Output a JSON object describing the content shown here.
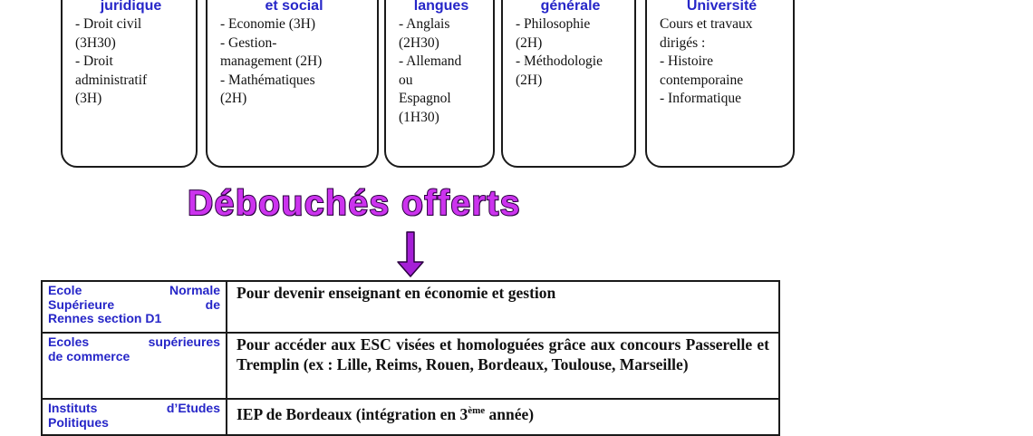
{
  "boxes": [
    {
      "title": "juridique",
      "lines": [
        "- Droit civil",
        "(3H30)",
        "- Droit",
        "administratif",
        "(3H)"
      ]
    },
    {
      "title": "et social",
      "lines": [
        "- Economie (3H)",
        "- Gestion-",
        "management (2H)",
        "- Mathématiques",
        "(2H)"
      ]
    },
    {
      "title": "langues",
      "lines": [
        "- Anglais",
        "(2H30)",
        "- Allemand",
        "ou",
        "Espagnol",
        "(1H30)"
      ]
    },
    {
      "title": "générale",
      "lines": [
        "- Philosophie",
        "(2H)",
        "- Méthodologie",
        "(2H)"
      ]
    },
    {
      "title": "Université",
      "lines": [
        "Cours et travaux",
        "dirigés :",
        "- Histoire",
        "contemporaine",
        "- Informatique"
      ]
    }
  ],
  "debouches_title": "Débouchés offerts",
  "table": {
    "rows": [
      {
        "school": [
          "Ecole Normale",
          "Supérieure de",
          "Rennes section D1"
        ],
        "desc": "Pour devenir enseignant en économie et gestion",
        "desc_sup": "",
        "desc_after": ""
      },
      {
        "school": [
          "Ecoles supérieures",
          "de commerce"
        ],
        "desc": "Pour accéder aux ESC visées et homologuées grâce aux concours Passerelle et Tremplin (ex : Lille, Reims, Rouen, Bordeaux, Toulouse, Marseille)",
        "desc_sup": "",
        "desc_after": ""
      },
      {
        "school": [
          "Instituts d’Etudes",
          "Politiques"
        ],
        "desc": "IEP de Bordeaux (intégration en 3",
        "desc_sup": "ème",
        "desc_after": " année)"
      }
    ]
  },
  "colors": {
    "heading_blue": "#2626c8",
    "title_violet": "#cc33ee",
    "arrow_violet": "#a51fd6"
  }
}
